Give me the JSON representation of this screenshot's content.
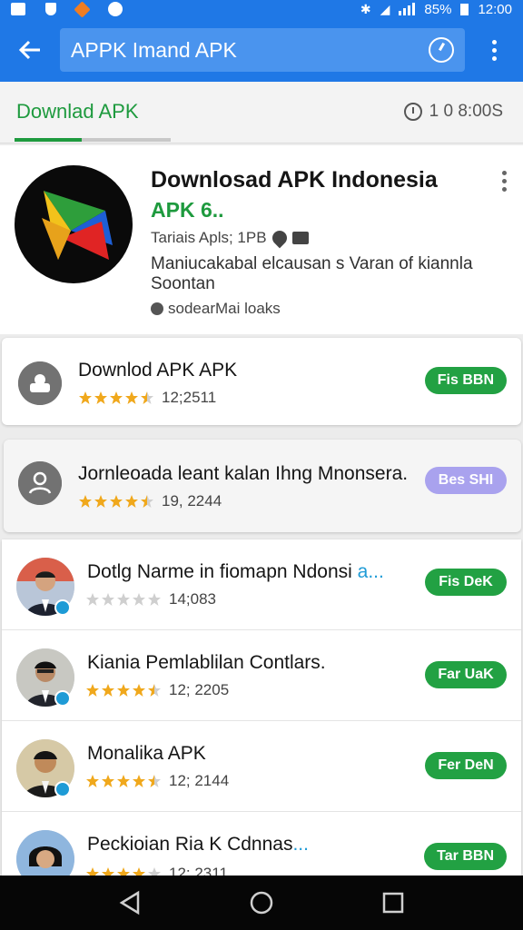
{
  "status_bar": {
    "battery": "85%",
    "time": "12:00",
    "icons": [
      "notification-icon",
      "shield-icon",
      "fire-icon",
      "circle-icon",
      "bluetooth-icon",
      "wifi-icon",
      "signal-icon",
      "battery-icon"
    ]
  },
  "app_bar": {
    "back_icon": "arrow-left-icon",
    "search_value": "APPK Imand APK",
    "mic_icon": "clock-search-icon",
    "more_icon": "kebab-icon",
    "color": "#1f78e6"
  },
  "tabs": {
    "active_label": "Downlad APK",
    "meta": "1 0 8:00S",
    "accent": "#1e9a3e"
  },
  "featured": {
    "title": "Downlosad APK Indonesia",
    "subtitle": "APK 6..",
    "meta": "Tariais Apls; 1PB",
    "description": "Maniucakabal elcausan s Varan of kiannla Soontan",
    "developer": "sodearMai loaks"
  },
  "cards": [
    {
      "title": "Downlod APK APK",
      "rating_stars": 4.5,
      "count": "12;2511",
      "action": "Fis BBN",
      "action_color": "#22a143"
    },
    {
      "title": "Jornleoada leant kalan Ihng Mnonsera.",
      "rating_stars": 4.5,
      "count": "19, 2244",
      "action": "Bes SHI",
      "action_color": "#a9a2ee"
    }
  ],
  "list": [
    {
      "title": "Dotlg Narme  in fiomapn Ndonsi",
      "ellipsis": "a...",
      "rating_stars": 0,
      "count": "14;083",
      "action": "Fis DeK"
    },
    {
      "title": "Kiania Pemlablilan Contlars.",
      "ellipsis": "",
      "rating_stars": 4.5,
      "count": "12; 2205",
      "action": "Far UaK"
    },
    {
      "title": "Monalika APK",
      "ellipsis": "",
      "rating_stars": 4.5,
      "count": "12; 2144",
      "action": "Fer DeN"
    },
    {
      "title": "Peckioian Ria K Cdnnas",
      "ellipsis": "...",
      "rating_stars": 4,
      "count": "12; 2311",
      "action": "Tar BBN"
    }
  ],
  "nav": {
    "back": "back-triangle-icon",
    "home": "home-circle-icon",
    "recents": "recents-square-icon"
  }
}
